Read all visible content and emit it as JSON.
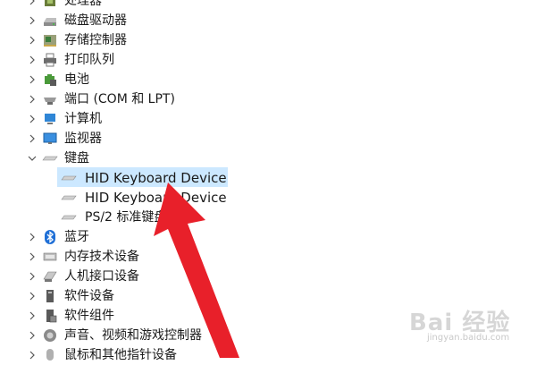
{
  "device_tree": {
    "items": [
      {
        "label": "处理器",
        "icon": "processor-icon",
        "expanded": false
      },
      {
        "label": "磁盘驱动器",
        "icon": "disk-drive-icon",
        "expanded": false
      },
      {
        "label": "存储控制器",
        "icon": "storage-controller-icon",
        "expanded": false
      },
      {
        "label": "打印队列",
        "icon": "printer-icon",
        "expanded": false
      },
      {
        "label": "电池",
        "icon": "battery-icon",
        "expanded": false
      },
      {
        "label": "端口 (COM 和 LPT)",
        "icon": "port-icon",
        "expanded": false
      },
      {
        "label": "计算机",
        "icon": "computer-icon",
        "expanded": false
      },
      {
        "label": "监视器",
        "icon": "monitor-icon",
        "expanded": false
      },
      {
        "label": "键盘",
        "icon": "keyboard-icon",
        "expanded": true,
        "children": [
          {
            "label": "HID Keyboard Device",
            "icon": "keyboard-icon",
            "selected": true
          },
          {
            "label": "HID Keyboard Device",
            "icon": "keyboard-icon",
            "selected": false
          },
          {
            "label": "PS/2 标准键盘",
            "icon": "keyboard-icon",
            "selected": false
          }
        ]
      },
      {
        "label": "蓝牙",
        "icon": "bluetooth-icon",
        "expanded": false
      },
      {
        "label": "内存技术设备",
        "icon": "memory-device-icon",
        "expanded": false
      },
      {
        "label": "人机接口设备",
        "icon": "hid-icon",
        "expanded": false
      },
      {
        "label": "软件设备",
        "icon": "software-device-icon",
        "expanded": false
      },
      {
        "label": "软件组件",
        "icon": "software-component-icon",
        "expanded": false
      },
      {
        "label": "声音、视频和游戏控制器",
        "icon": "speaker-icon",
        "expanded": false
      },
      {
        "label": "鼠标和其他指针设备",
        "icon": "mouse-icon",
        "expanded": false
      }
    ]
  },
  "colors": {
    "selection": "#cce8ff",
    "arrow": "#e8202a",
    "bluetooth": "#1f6fd6"
  },
  "watermark": {
    "text": "Bai 经验",
    "url": "jingyan.baidu.com"
  }
}
